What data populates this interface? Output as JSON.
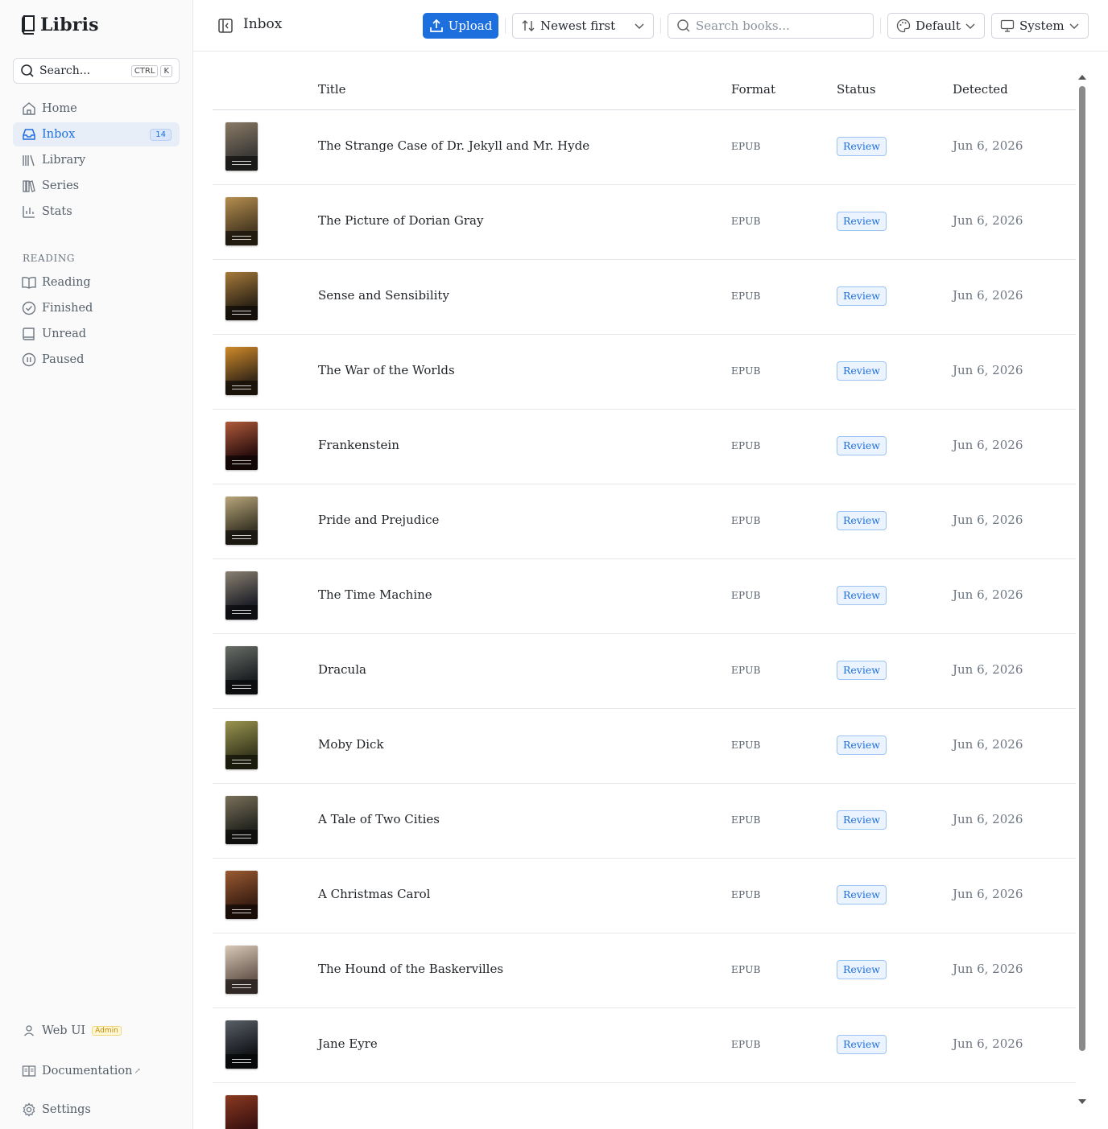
{
  "app": {
    "name": "Libris"
  },
  "sidebar": {
    "search_placeholder": "Search...",
    "kbd_ctrl": "CTRL",
    "kbd_k": "K",
    "nav": [
      {
        "label": "Home",
        "icon": "home-icon"
      },
      {
        "label": "Inbox",
        "icon": "inbox-icon",
        "badge": "14",
        "active": true
      },
      {
        "label": "Library",
        "icon": "library-icon"
      },
      {
        "label": "Series",
        "icon": "series-icon"
      },
      {
        "label": "Stats",
        "icon": "stats-icon"
      }
    ],
    "reading_section": "READING",
    "reading": [
      {
        "label": "Reading",
        "icon": "book-open-icon"
      },
      {
        "label": "Finished",
        "icon": "check-circle-icon"
      },
      {
        "label": "Unread",
        "icon": "book-icon"
      },
      {
        "label": "Paused",
        "icon": "pause-circle-icon"
      }
    ],
    "user_label": "Web UI",
    "user_role": "Admin",
    "docs_label": "Documentation",
    "docs_ext": "↗",
    "settings_label": "Settings"
  },
  "header": {
    "title": "Inbox",
    "upload_label": "Upload",
    "sort_label": "Newest first",
    "search_placeholder": "Search books...",
    "theme_label": "Default",
    "mode_label": "System"
  },
  "table": {
    "columns": {
      "title": "Title",
      "format": "Format",
      "status": "Status",
      "detected": "Detected"
    },
    "rows": [
      {
        "title": "The Strange Case of Dr. Jekyll and Mr. Hyde",
        "format": "EPUB",
        "status": "Review",
        "detected": "Jun 6, 2026",
        "cover": [
          "#3b3a36",
          "#8a7a66"
        ]
      },
      {
        "title": "The Picture of Dorian Gray",
        "format": "EPUB",
        "status": "Review",
        "detected": "Jun 6, 2026",
        "cover": [
          "#4a3a22",
          "#b58e4f"
        ]
      },
      {
        "title": "Sense and Sensibility",
        "format": "EPUB",
        "status": "Review",
        "detected": "Jun 6, 2026",
        "cover": [
          "#2e2416",
          "#a67a3a"
        ]
      },
      {
        "title": "The War of the Worlds",
        "format": "EPUB",
        "status": "Review",
        "detected": "Jun 6, 2026",
        "cover": [
          "#3a2a18",
          "#d08a2a"
        ]
      },
      {
        "title": "Frankenstein",
        "format": "EPUB",
        "status": "Review",
        "detected": "Jun 6, 2026",
        "cover": [
          "#2a0e0e",
          "#b05a3a"
        ]
      },
      {
        "title": "Pride and Prejudice",
        "format": "EPUB",
        "status": "Review",
        "detected": "Jun 6, 2026",
        "cover": [
          "#3a3526",
          "#b8a67a"
        ]
      },
      {
        "title": "The Time Machine",
        "format": "EPUB",
        "status": "Review",
        "detected": "Jun 6, 2026",
        "cover": [
          "#1e2028",
          "#8a8070"
        ]
      },
      {
        "title": "Dracula",
        "format": "EPUB",
        "status": "Review",
        "detected": "Jun 6, 2026",
        "cover": [
          "#1c1f22",
          "#6a6e68"
        ]
      },
      {
        "title": "Moby Dick",
        "format": "EPUB",
        "status": "Review",
        "detected": "Jun 6, 2026",
        "cover": [
          "#3a3a1e",
          "#9a9450"
        ]
      },
      {
        "title": "A Tale of Two Cities",
        "format": "EPUB",
        "status": "Review",
        "detected": "Jun 6, 2026",
        "cover": [
          "#22241e",
          "#7a705a"
        ]
      },
      {
        "title": "A Christmas Carol",
        "format": "EPUB",
        "status": "Review",
        "detected": "Jun 6, 2026",
        "cover": [
          "#3a1e12",
          "#9a5a32"
        ]
      },
      {
        "title": "The Hound of the Baskervilles",
        "format": "EPUB",
        "status": "Review",
        "detected": "Jun 6, 2026",
        "cover": [
          "#6a5a50",
          "#d8c8b8"
        ]
      },
      {
        "title": "Jane Eyre",
        "format": "EPUB",
        "status": "Review",
        "detected": "Jun 6, 2026",
        "cover": [
          "#121418",
          "#5a6068"
        ]
      },
      {
        "title": "",
        "format": "",
        "status": "",
        "detected": "",
        "cover": [
          "#3a1010",
          "#8a3a20"
        ]
      }
    ]
  },
  "colors": {
    "accent": "#1d6fde",
    "badge_bg": "#eaf3fe",
    "admin": "#c08a00"
  }
}
